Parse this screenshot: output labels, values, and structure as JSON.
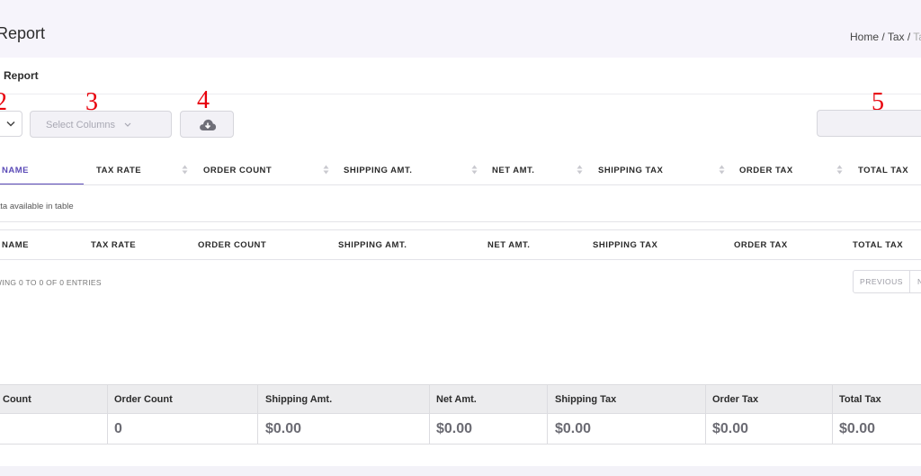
{
  "page": {
    "title": "Report",
    "breadcrumb": {
      "home": "Home",
      "sep1": " / ",
      "tax": "Tax",
      "sep2": " / ",
      "current": "Ta"
    }
  },
  "card": {
    "title": "Report"
  },
  "markers": {
    "m2": "2",
    "m3": "3",
    "m4": "4",
    "m5": "5"
  },
  "controls": {
    "columns_placeholder": "Select Columns",
    "download_icon": "cloud-download-icon"
  },
  "table": {
    "header": [
      "NAME",
      "TAX RATE",
      "ORDER COUNT",
      "SHIPPING AMT.",
      "NET AMT.",
      "SHIPPING TAX",
      "ORDER TAX",
      "TOTAL TAX"
    ],
    "footer": [
      "NAME",
      "TAX RATE",
      "ORDER COUNT",
      "SHIPPING AMT.",
      "NET AMT.",
      "SHIPPING TAX",
      "ORDER TAX",
      "TOTAL TAX"
    ],
    "empty_message": "ata available in table",
    "info": "WING 0 TO 0 OF 0 ENTRIES",
    "active_color": "#5b4bb7"
  },
  "pagination": {
    "previous": "PREVIOUS",
    "next": "N"
  },
  "summary": {
    "headers": [
      "Count",
      "Order Count",
      "Shipping Amt.",
      "Net Amt.",
      "Shipping Tax",
      "Order Tax",
      "Total Tax"
    ],
    "values": [
      "",
      "0",
      "$0.00",
      "$0.00",
      "$0.00",
      "$0.00",
      "$0.00"
    ]
  },
  "colors": {
    "accent": "#5b4bb7",
    "marker": "#e8000b"
  }
}
